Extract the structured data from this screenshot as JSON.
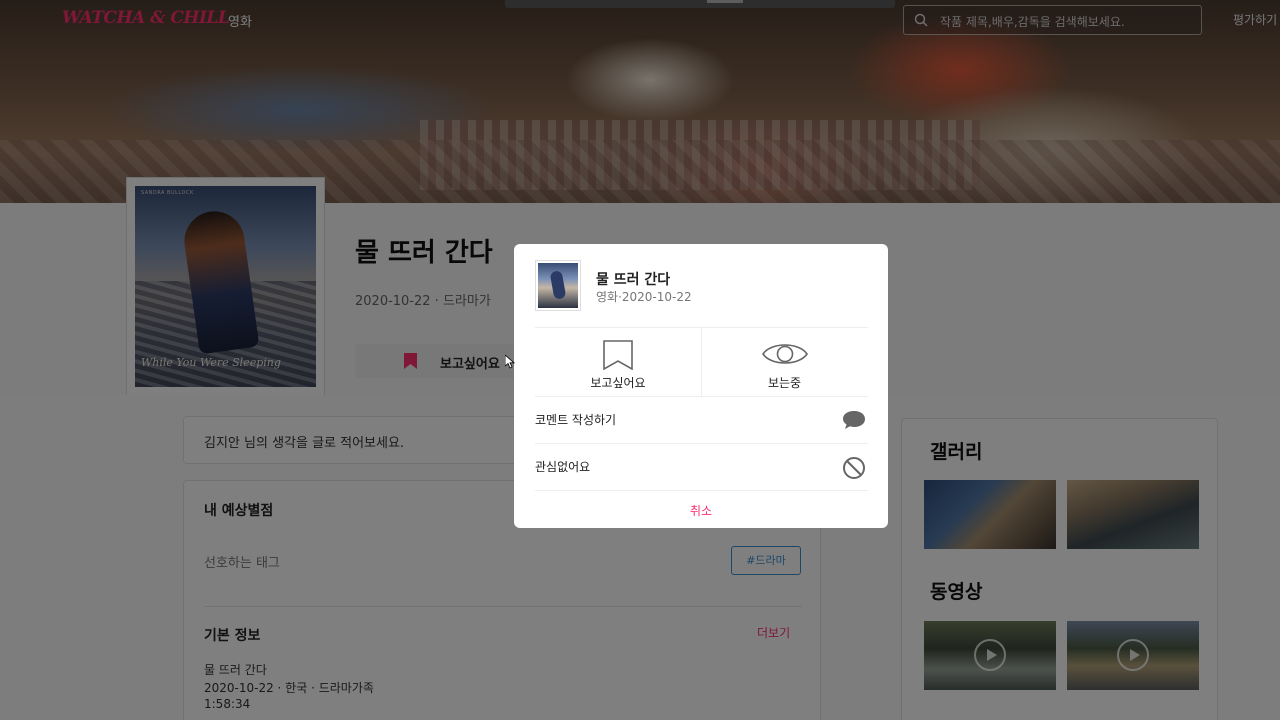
{
  "header": {
    "logo": "WATCHA & CHILL",
    "nav_movie": "영화",
    "search_placeholder": "작품 제목,배우,감독을 검색해보세요.",
    "rate_link": "평가하기"
  },
  "movie": {
    "title": "물 뜨러 간다",
    "meta": "2020-10-22 · 드라마가",
    "want_label": "보고싶어요",
    "poster": {
      "top_text": "SANDRA BULLOCK",
      "title_text": "While You Were Sleeping"
    }
  },
  "content": {
    "comment_prompt": "김지안 님의 생각을 글로 적어보세요.",
    "rating_title": "내 예상별점",
    "pref_tag_label": "선호하는 태그",
    "tag": "#드라마",
    "basic_info_title": "기본 정보",
    "more": "더보기",
    "info_lines": [
      "물 뜨러 간다",
      "2020-10-22 · 한국 · 드라마가족",
      "1:58:34"
    ]
  },
  "side": {
    "gallery_title": "갤러리",
    "video_title": "동영상"
  },
  "modal": {
    "title": "물 뜨러 간다",
    "subtitle": "영화·2020-10-22",
    "want": "보고싶어요",
    "watching": "보는중",
    "write_comment": "코멘트 작성하기",
    "not_interested": "관심없어요",
    "cancel": "취소"
  },
  "colors": {
    "accent": "#ff2f6e",
    "tag_blue": "#3b8fcf"
  }
}
